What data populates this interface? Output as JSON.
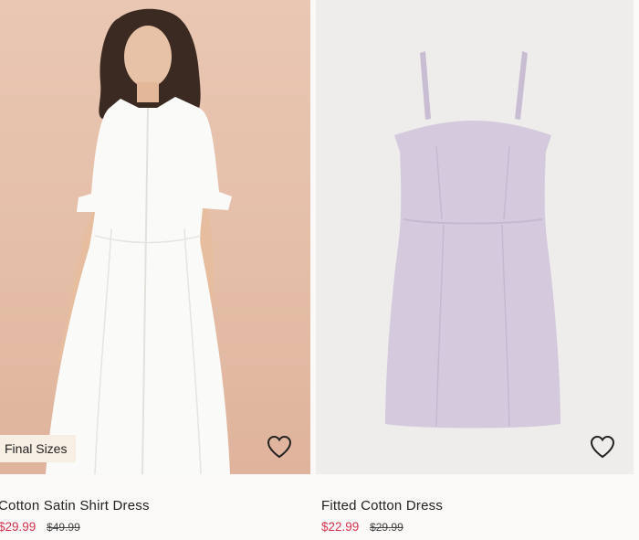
{
  "products": [
    {
      "name": "Cotton Satin Shirt Dress",
      "sale_price": "$29.99",
      "original_price": "$49.99",
      "badge": "Final Sizes",
      "favorite_icon": "heart-outline-icon"
    },
    {
      "name": "Fitted Cotton Dress",
      "sale_price": "$22.99",
      "original_price": "$29.99",
      "favorite_icon": "heart-outline-icon"
    }
  ],
  "colors": {
    "sale_price": "#d6334c",
    "badge_bg": "#f7eee4"
  }
}
